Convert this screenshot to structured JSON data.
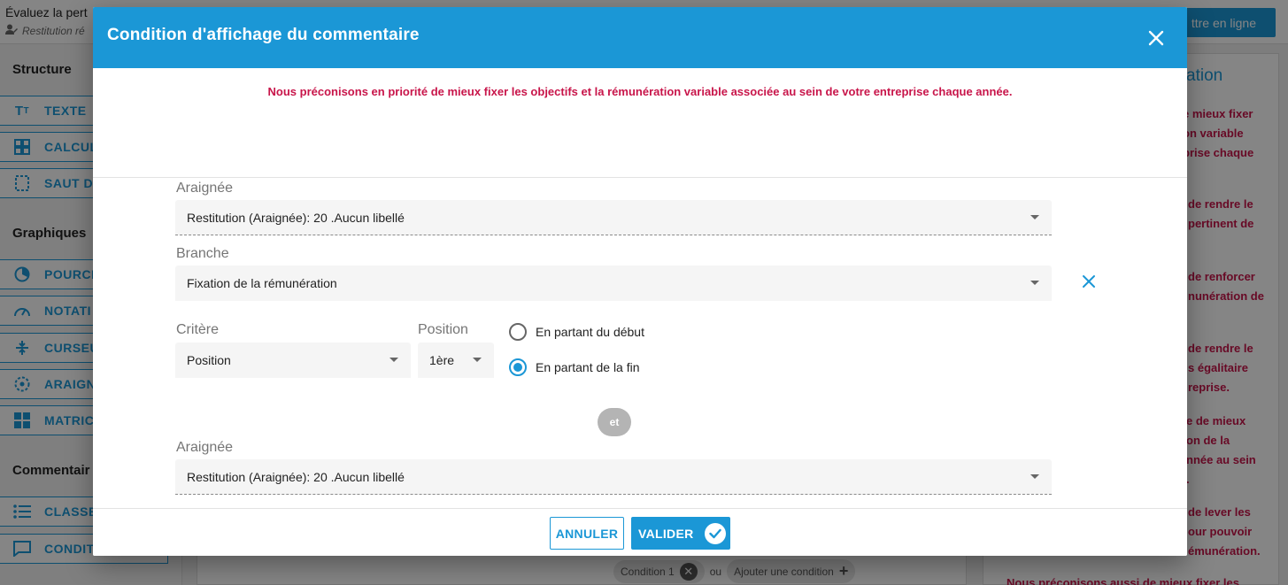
{
  "background": {
    "page_title": "Évaluez la pert",
    "page_subtitle": "Restitution ré",
    "publish_label": "ttre en ligne",
    "sidebar": {
      "sections": [
        "Structure",
        "Graphiques",
        "Commentair"
      ],
      "items": [
        {
          "label": "TEXTE",
          "icon": "text-format-icon"
        },
        {
          "label": "CALCUL",
          "icon": "grid-icon"
        },
        {
          "label": "SAUT D",
          "icon": "page-break-icon"
        },
        {
          "label": "POURCE",
          "icon": "pie-chart-icon"
        },
        {
          "label": "NOTATI",
          "icon": "gauge-icon"
        },
        {
          "label": "CURSEU",
          "icon": "slider-icon"
        },
        {
          "label": "ARAIGN",
          "icon": "radar-icon"
        },
        {
          "label": "MATRIC",
          "icon": "matrix-icon"
        },
        {
          "label": "CLASSE",
          "icon": "list-icon"
        },
        {
          "label": "CONDIT",
          "icon": "comment-icon"
        }
      ]
    },
    "right_panel": {
      "title": "ation",
      "paragraphs": [
        "e mieux fixer\non variable\nprise chaque",
        "de rendre le\npertinent de",
        "de renforcer\nnunération de",
        "de rendre le\ns égalitaire\nreprise.",
        "e de mieux\non de la\nnnée au sein\n.",
        "de lever les\nour pouvoir\némunération.",
        "Nous préconisons aussi de mieux fixer les"
      ]
    },
    "conditions_bar": {
      "chip_label": "Condition 1",
      "separator": "ou",
      "add_label": "Ajouter une condition"
    }
  },
  "modal": {
    "title": "Condition d'affichage du commentaire",
    "notice": "Nous préconisons en priorité de mieux fixer les objectifs et la rémunération variable associée au sein de votre entreprise chaque année.",
    "block1": {
      "araignee_label": "Araignée",
      "araignee_value": "Restitution (Araignée): 20 .Aucun libellé",
      "branche_label": "Branche",
      "branche_value": "Fixation de la rémunération",
      "critere_label": "Critère",
      "critere_value": "Position",
      "position_label": "Position",
      "position_value": "1ère",
      "radio_options": [
        {
          "label": "En partant du début",
          "checked": false
        },
        {
          "label": "En partant de la fin",
          "checked": true
        }
      ]
    },
    "joiner": "et",
    "block2": {
      "araignee_label": "Araignée",
      "araignee_value": "Restitution (Araignée): 20 .Aucun libellé"
    },
    "cancel_label": "ANNULER",
    "ok_label": "VALIDER"
  },
  "colors": {
    "primary": "#1b97d6",
    "alert_text": "#c8154a"
  }
}
